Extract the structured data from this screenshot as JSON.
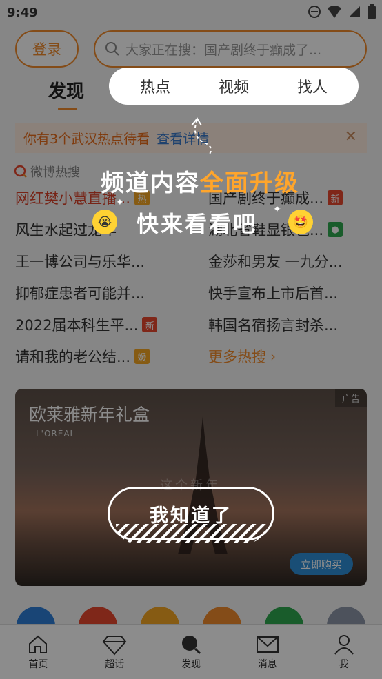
{
  "status_bar": {
    "time": "9:49"
  },
  "header": {
    "login_label": "登录",
    "search_placeholder": "大家正在搜：国产剧终于癫成了..."
  },
  "tabs": {
    "discover": "发现"
  },
  "notice": {
    "text": "你有3个武汉热点待看",
    "link": "查看详情"
  },
  "hot_search": {
    "label": "微博热搜",
    "items": [
      {
        "text": "网红樊小慧直播...",
        "badge": "热"
      },
      {
        "text": "国产剧终于癫成...",
        "badge": "新"
      },
      {
        "text": "风生水起过龙年",
        "badge": ""
      },
      {
        "text": "湖北省鞋显银包...",
        "badge": ""
      },
      {
        "text": "王一博公司与乐华...",
        "badge": ""
      },
      {
        "text": "金莎和男友 一九分...",
        "badge": ""
      },
      {
        "text": "抑郁症患者可能并...",
        "badge": ""
      },
      {
        "text": "快手宣布上市后首...",
        "badge": ""
      },
      {
        "text": "2022届本科生平...",
        "badge": "新"
      },
      {
        "text": "韩国名宿扬言封杀...",
        "badge": ""
      },
      {
        "text": "请和我的老公结...",
        "badge": "媛"
      },
      {
        "text": "更多热搜",
        "badge": ""
      }
    ]
  },
  "ad": {
    "title": "欧莱雅新年礼盒",
    "brand": "L'ORÉAL",
    "tag": "广告",
    "buy_label": "立即购买",
    "overlay_text": "这个新年"
  },
  "bottom_nav": {
    "items": [
      {
        "label": "首页"
      },
      {
        "label": "超话"
      },
      {
        "label": "发现"
      },
      {
        "label": "消息"
      },
      {
        "label": "我"
      }
    ]
  },
  "guide": {
    "tabs": [
      "热点",
      "视频",
      "找人"
    ],
    "title_plain": "频道内容",
    "title_accent": "全面升级",
    "subtitle": "快来看看吧",
    "confirm_label": "我知道了"
  },
  "colors": {
    "accent": "#f08b2c",
    "guide_accent": "#ffa52b",
    "link": "#3a78c9"
  }
}
